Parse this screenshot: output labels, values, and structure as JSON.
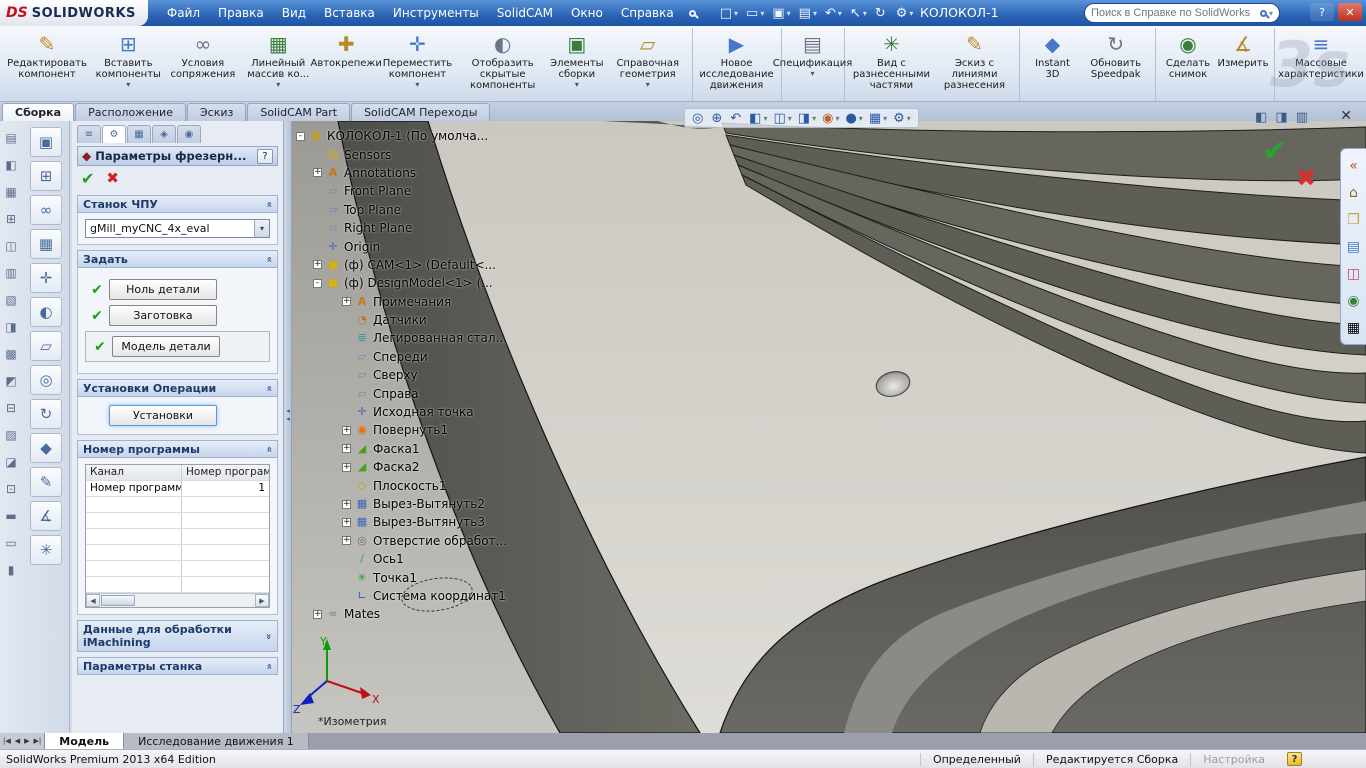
{
  "titlebar": {
    "logo_ds": "DS",
    "logo_text": "SOLIDWORKS",
    "menus": [
      "Файл",
      "Правка",
      "Вид",
      "Вставка",
      "Инструменты",
      "SolidCAM",
      "Окно",
      "Справка"
    ],
    "quick_tools": [
      {
        "name": "new-document-icon",
        "glyph": "□",
        "arrow": "▾"
      },
      {
        "name": "open-icon",
        "glyph": "▭",
        "arrow": "▾"
      },
      {
        "name": "save-icon",
        "glyph": "▣",
        "arrow": "▾"
      },
      {
        "name": "print-icon",
        "glyph": "▤",
        "arrow": "▾"
      },
      {
        "name": "undo-icon",
        "glyph": "↶",
        "arrow": "▾"
      },
      {
        "name": "select-icon",
        "glyph": "↖",
        "arrow": "▾"
      },
      {
        "name": "rebuild-icon",
        "glyph": "↻",
        "arrow": ""
      },
      {
        "name": "options-icon",
        "glyph": "⚙",
        "arrow": "▾"
      }
    ],
    "document_title": "КОЛОКОЛ-1",
    "search_placeholder": "Поиск в Справке по SolidWorks",
    "window_buttons": {
      "help": "?",
      "close": "✕"
    }
  },
  "ribbon": {
    "watermark": "3s",
    "buttons": [
      {
        "name": "edit-component-button",
        "label": "Редактировать компонент",
        "glyph": "✎",
        "arrow": "",
        "divider": ""
      },
      {
        "name": "insert-components-button",
        "label": "Вставить компоненты",
        "glyph": "⊞",
        "arrow": "▾",
        "divider": ""
      },
      {
        "name": "mate-button",
        "label": "Условия сопряжения",
        "glyph": "∞",
        "arrow": "",
        "divider": ""
      },
      {
        "name": "linear-pattern-button",
        "label": "Линейный массив ко...",
        "glyph": "▦",
        "arrow": "▾",
        "divider": ""
      },
      {
        "name": "smart-fasteners-button",
        "label": "Автокрепежи",
        "glyph": "✚",
        "arrow": "",
        "divider": ""
      },
      {
        "name": "move-component-button",
        "label": "Переместить компонент",
        "glyph": "✛",
        "arrow": "▾",
        "divider": ""
      },
      {
        "name": "show-hidden-components-button",
        "label": "Отобразить скрытые компоненты",
        "glyph": "◐",
        "arrow": "",
        "divider": ""
      },
      {
        "name": "assembly-features-button",
        "label": "Элементы сборки",
        "glyph": "▣",
        "arrow": "▾",
        "divider": ""
      },
      {
        "name": "reference-geometry-button",
        "label": "Справочная геометрия",
        "glyph": "▱",
        "arrow": "▾",
        "divider": "1"
      },
      {
        "name": "new-motion-study-button",
        "label": "Новое исследование движения",
        "glyph": "▶",
        "arrow": "",
        "divider": "1"
      },
      {
        "name": "bill-of-materials-button",
        "label": "Спецификация",
        "glyph": "▤",
        "arrow": "▾",
        "divider": "1"
      },
      {
        "name": "exploded-view-button",
        "label": "Вид с разнесенными частями",
        "glyph": "✳",
        "arrow": "",
        "divider": ""
      },
      {
        "name": "explode-line-sketch-button",
        "label": "Эскиз с линиями разнесения",
        "glyph": "✎",
        "arrow": "",
        "divider": "1"
      },
      {
        "name": "instant-3d-button",
        "label": "Instant 3D",
        "glyph": "◆",
        "arrow": "",
        "divider": ""
      },
      {
        "name": "update-speedpak-button",
        "label": "Обновить Speedpak",
        "glyph": "↻",
        "arrow": "",
        "divider": "1"
      },
      {
        "name": "take-snapshot-button",
        "label": "Сделать снимок",
        "glyph": "◉",
        "arrow": "",
        "divider": ""
      },
      {
        "name": "measure-button",
        "label": "Измерить",
        "glyph": "∡",
        "arrow": "",
        "divider": "1"
      },
      {
        "name": "mass-properties-button",
        "label": "Массовые характеристики",
        "glyph": "≡",
        "arrow": "",
        "divider": ""
      }
    ]
  },
  "command_tabs": [
    {
      "label": "Сборка",
      "active": "true"
    },
    {
      "label": "Расположение",
      "active": "false"
    },
    {
      "label": "Эскиз",
      "active": "false"
    },
    {
      "label": "SolidCAM Part",
      "active": "false"
    },
    {
      "label": "SolidCAM Переходы",
      "active": "false"
    }
  ],
  "left_toolbar": {
    "col1": [
      {
        "glyph": "▤"
      },
      {
        "glyph": "◧"
      },
      {
        "glyph": "▦"
      },
      {
        "glyph": "⊞"
      },
      {
        "glyph": "◫"
      },
      {
        "glyph": "▥"
      },
      {
        "glyph": "▧"
      },
      {
        "glyph": "◨"
      },
      {
        "glyph": "▩"
      },
      {
        "glyph": "◩"
      },
      {
        "glyph": "⊟"
      },
      {
        "glyph": "▨"
      },
      {
        "glyph": "◪"
      },
      {
        "glyph": "⊡"
      },
      {
        "glyph": "▬"
      },
      {
        "glyph": "▭"
      },
      {
        "glyph": "▮"
      }
    ],
    "col2": [
      {
        "glyph": "▣"
      },
      {
        "glyph": "⊞"
      },
      {
        "glyph": "∞"
      },
      {
        "glyph": "▦"
      },
      {
        "glyph": "✛"
      },
      {
        "glyph": "◐"
      },
      {
        "glyph": "▱"
      },
      {
        "glyph": "◎"
      },
      {
        "glyph": "↻"
      },
      {
        "glyph": "◆"
      },
      {
        "glyph": "✎"
      },
      {
        "glyph": "∡"
      },
      {
        "glyph": "✳"
      }
    ]
  },
  "property_panel": {
    "tabs": [
      {
        "name": "featuremanager-tab",
        "glyph": "≡",
        "active": "false"
      },
      {
        "name": "propertymanager-tab",
        "glyph": "⚙",
        "active": "true"
      },
      {
        "name": "configurationmanager-tab",
        "glyph": "▦",
        "active": "false"
      },
      {
        "name": "dimxpertmanager-tab",
        "glyph": "◈",
        "active": "false"
      },
      {
        "name": "displaymanager-tab",
        "glyph": "◉",
        "active": "false"
      }
    ],
    "title": "Параметры фрезерн...",
    "help_label": "?",
    "check_glyph": "✔",
    "cancel_glyph": "✖",
    "sections": {
      "machine": {
        "title": "Станок ЧПУ",
        "combo_value": "gMill_myCNC_4x_eval",
        "combo_arrow": "▾"
      },
      "define": {
        "title": "Задать",
        "rows": [
          {
            "label": "Ноль детали",
            "boxed": ""
          },
          {
            "label": "Заготовка",
            "boxed": ""
          },
          {
            "label": "Модель детали",
            "boxed": "1"
          }
        ]
      },
      "setup": {
        "title": "Установки Операции",
        "button_label": "Установки"
      },
      "program": {
        "title": "Номер программы",
        "table": {
          "headers": [
            "Канал",
            "Номер программы"
          ],
          "row_label": "Номер программы",
          "row_value": "1"
        }
      },
      "imachining": {
        "title": "Данные для обработки iMachining"
      },
      "machine_params": {
        "title": "Параметры станка"
      }
    }
  },
  "feature_tree": {
    "items": [
      {
        "label": "КОЛОКОЛ-1 (По умолча...",
        "level": 0,
        "exp": "-",
        "icon": "assembly"
      },
      {
        "label": "Sensors",
        "level": 1,
        "exp": "",
        "icon": "folder"
      },
      {
        "label": "Annotations",
        "level": 1,
        "exp": "+",
        "icon": "annotations"
      },
      {
        "label": "Front Plane",
        "level": 1,
        "exp": "",
        "icon": "plane"
      },
      {
        "label": "Top Plane",
        "level": 1,
        "exp": "",
        "icon": "plane"
      },
      {
        "label": "Right Plane",
        "level": 1,
        "exp": "",
        "icon": "plane"
      },
      {
        "label": "Origin",
        "level": 1,
        "exp": "",
        "icon": "origin"
      },
      {
        "label": "(ф) CAM<1> (Default<...",
        "level": 1,
        "exp": "+",
        "icon": "part"
      },
      {
        "label": "(ф) DesignModel<1> (...",
        "level": 1,
        "exp": "-",
        "icon": "part"
      },
      {
        "label": "Примечания",
        "level": 2,
        "exp": "+",
        "icon": "annotations"
      },
      {
        "label": "Датчики",
        "level": 2,
        "exp": "",
        "icon": "sensor"
      },
      {
        "label": "Легированная стал...",
        "level": 2,
        "exp": "",
        "icon": "material"
      },
      {
        "label": "Спереди",
        "level": 2,
        "exp": "",
        "icon": "plane"
      },
      {
        "label": "Сверху",
        "level": 2,
        "exp": "",
        "icon": "plane"
      },
      {
        "label": "Справа",
        "level": 2,
        "exp": "",
        "icon": "plane"
      },
      {
        "label": "Исходная точка",
        "level": 2,
        "exp": "",
        "icon": "origin"
      },
      {
        "label": "Повернуть1",
        "level": 2,
        "exp": "+",
        "icon": "revolve"
      },
      {
        "label": "Фаска1",
        "level": 2,
        "exp": "+",
        "icon": "chamfer"
      },
      {
        "label": "Фаска2",
        "level": 2,
        "exp": "+",
        "icon": "chamfer"
      },
      {
        "label": "Плоскость1",
        "level": 2,
        "exp": "",
        "icon": "plane2"
      },
      {
        "label": "Вырез-Вытянуть2",
        "level": 2,
        "exp": "+",
        "icon": "cut"
      },
      {
        "label": "Вырез-Вытянуть3",
        "level": 2,
        "exp": "+",
        "icon": "cut"
      },
      {
        "label": "Отверстие обработ...",
        "level": 2,
        "exp": "+",
        "icon": "hole"
      },
      {
        "label": "Ось1",
        "level": 2,
        "exp": "",
        "icon": "axis"
      },
      {
        "label": "Точка1",
        "level": 2,
        "exp": "",
        "icon": "point"
      },
      {
        "label": "Система координат1",
        "level": 2,
        "exp": "",
        "icon": "csys"
      },
      {
        "label": "Mates",
        "level": 1,
        "exp": "+",
        "icon": "mates"
      }
    ]
  },
  "viewport": {
    "view_label": "*Изометрия",
    "hud_icons": [
      {
        "name": "zoom-fit-icon",
        "glyph": "◎",
        "arrow": ""
      },
      {
        "name": "zoom-area-icon",
        "glyph": "⊕",
        "arrow": ""
      },
      {
        "name": "previous-view-icon",
        "glyph": "↶",
        "arrow": ""
      },
      {
        "name": "section-view-icon",
        "glyph": "◧",
        "arrow": "▾"
      },
      {
        "name": "view-orientation-icon",
        "glyph": "◫",
        "arrow": "▾"
      },
      {
        "name": "display-style-icon",
        "glyph": "◨",
        "arrow": "▾"
      },
      {
        "name": "hide-show-items-icon",
        "glyph": "◉",
        "arrow": "▾"
      },
      {
        "name": "edit-appearance-icon",
        "glyph": "●",
        "arrow": "▾"
      },
      {
        "name": "apply-scene-icon",
        "glyph": "▦",
        "arrow": "▾"
      },
      {
        "name": "view-settings-icon",
        "glyph": "⚙",
        "arrow": "▾"
      }
    ],
    "pane_controls": [
      {
        "name": "featuremanager-pane-icon",
        "glyph": "◧"
      },
      {
        "name": "split-display-pane-icon",
        "glyph": "◨"
      },
      {
        "name": "pane-options-icon",
        "glyph": "▥"
      }
    ],
    "flyout_close": "✕",
    "confirm_ok": "✔",
    "confirm_cancel": "✖",
    "triad": {
      "x": "X",
      "y": "Y",
      "z": "Z"
    }
  },
  "taskpane_icons": [
    {
      "name": "collapse-taskpane-icon",
      "glyph": "«"
    },
    {
      "name": "solidworks-resources-icon",
      "glyph": "⌂"
    },
    {
      "name": "design-library-icon",
      "glyph": "❒"
    },
    {
      "name": "file-explorer-icon",
      "glyph": "▤"
    },
    {
      "name": "view-palette-icon",
      "glyph": "◫"
    },
    {
      "name": "appearances-icon",
      "glyph": "◉"
    },
    {
      "name": "custom-properties-icon",
      "glyph": "▦"
    }
  ],
  "bottom": {
    "nav": [
      {
        "glyph": "|◀"
      },
      {
        "glyph": "◀"
      },
      {
        "glyph": "▶"
      },
      {
        "glyph": "▶|"
      }
    ],
    "tabs": [
      {
        "label": "Модель",
        "active": "true"
      },
      {
        "label": "Исследование движения 1",
        "active": "false"
      }
    ]
  },
  "statusbar": {
    "left": "SolidWorks Premium 2013 x64 Edition",
    "status": "Определенный",
    "mode": "Редактируется Сборка",
    "custom": "Настройка",
    "help_badge": "?"
  }
}
